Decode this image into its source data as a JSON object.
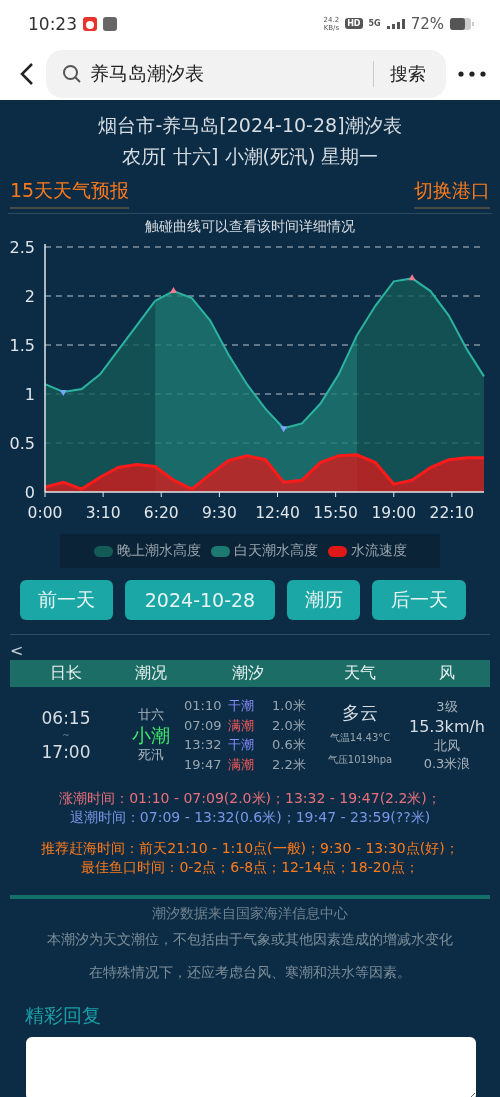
{
  "status_bar": {
    "time": "10:23",
    "net_speed": "24.2",
    "net_unit": "KB/s",
    "hd": "HD",
    "network": "5G",
    "battery": "72%"
  },
  "search_bar": {
    "query": "养马岛潮汐表",
    "button": "搜索"
  },
  "header": {
    "title": "烟台市-养马岛[2024-10-28]潮汐表",
    "subtitle": "农历[ 廿六] 小潮(死汛) 星期一",
    "links": [
      "15天天气预报",
      "切换港口"
    ],
    "hint": "触碰曲线可以查看该时间详细情况"
  },
  "chart_data": {
    "type": "area",
    "x": [
      0,
      60,
      120,
      180,
      240,
      300,
      360,
      420,
      480,
      540,
      600,
      660,
      720,
      780,
      840,
      900,
      960,
      1020,
      1080,
      1140,
      1200,
      1260,
      1320,
      1380,
      1435
    ],
    "xlim": [
      0,
      1435
    ],
    "ylim": [
      0,
      2.5
    ],
    "xticks": [
      {
        "value": 0,
        "label": "0:00"
      },
      {
        "value": 190,
        "label": "3:10"
      },
      {
        "value": 380,
        "label": "6:20"
      },
      {
        "value": 570,
        "label": "9:30"
      },
      {
        "value": 760,
        "label": "12:40"
      },
      {
        "value": 950,
        "label": "15:50"
      },
      {
        "value": 1140,
        "label": "19:00"
      },
      {
        "value": 1330,
        "label": "22:10"
      }
    ],
    "yticks": [
      0,
      {
        "value": 0.5,
        "label": "0.5"
      },
      1,
      {
        "value": 1.5,
        "label": "1.5"
      },
      2,
      {
        "value": 2.5,
        "label": "2.5"
      }
    ],
    "series": [
      {
        "name": "晚上潮水高度",
        "color": "#145a57",
        "values": [
          1.1,
          1.02,
          1.05,
          1.2,
          1.45,
          1.7,
          1.95,
          null,
          null,
          null,
          null,
          null,
          null,
          null,
          null,
          null,
          null,
          1.6,
          1.9,
          2.15,
          2.18,
          2.05,
          1.8,
          1.45,
          1.18
        ]
      },
      {
        "name": "白天潮水高度",
        "color": "#1d7a72",
        "values": [
          null,
          null,
          null,
          null,
          null,
          null,
          1.95,
          2.05,
          1.98,
          1.75,
          1.4,
          1.1,
          0.85,
          0.65,
          0.7,
          0.9,
          1.2,
          1.6,
          null,
          null,
          null,
          null,
          null,
          null,
          null
        ]
      },
      {
        "name": "水流速度",
        "color": "#e01818",
        "values": [
          0.05,
          0.1,
          0.03,
          0.15,
          0.25,
          0.28,
          0.26,
          0.12,
          0.03,
          0.18,
          0.32,
          0.37,
          0.33,
          0.1,
          0.12,
          0.3,
          0.37,
          0.38,
          0.3,
          0.08,
          0.12,
          0.25,
          0.33,
          0.35,
          0.35
        ]
      }
    ],
    "grid": true
  },
  "buttons": [
    {
      "label": "前一天"
    },
    {
      "label": "2024-10-28"
    },
    {
      "label": "潮历"
    },
    {
      "label": "后一天"
    }
  ],
  "back_link": "<",
  "table": {
    "columns": [
      "日长",
      "潮况",
      "潮汐",
      "天气",
      "风"
    ],
    "daylight": {
      "rise": "06:15",
      "separator": "~",
      "set": "17:00"
    },
    "tide_state": {
      "lunar": "廿六",
      "level": "小潮",
      "phase": "死汛"
    },
    "tides": [
      {
        "time": "01:10",
        "kind": "low",
        "label": "干潮",
        "height": "1.0米"
      },
      {
        "time": "07:09",
        "kind": "high",
        "label": "满潮",
        "height": "2.0米"
      },
      {
        "time": "13:32",
        "kind": "low",
        "label": "干潮",
        "height": "0.6米"
      },
      {
        "time": "19:47",
        "kind": "high",
        "label": "满潮",
        "height": "2.2米"
      }
    ],
    "weather": {
      "condition": "多云",
      "temperature": "气温14.43°C",
      "pressure": "气压1019hpa"
    },
    "wind": {
      "scale": "3级",
      "speed": "15.3km/h",
      "direction": "北风",
      "wave": "0.3米浪"
    }
  },
  "tide_times": [
    {
      "kind": "rise",
      "label": "涨潮时间：",
      "text": "01:10 - 07:09(2.0米)；13:32 - 19:47(2.2米)；"
    },
    {
      "kind": "fall",
      "label": "退潮时间：",
      "text": "07:09 - 13:32(0.6米)；19:47 - 23:59(??米)"
    }
  ],
  "advice": [
    {
      "label": "推荐赶海时间：",
      "text": "前天21:10 - 1:10点(一般)；9:30 - 13:30点(好)；"
    },
    {
      "label": "最佳鱼口时间：",
      "text": "0-2点；6-8点；12-14点；18-20点；"
    }
  ],
  "source": "潮汐数据来自国家海洋信息中心",
  "notes": [
    "本潮汐为天文潮位，不包括由于气象或其他因素造成的增减水变化",
    "在特殊情况下，还应考虑台风、寒潮和洪水等因素。"
  ],
  "replies": {
    "title": "精彩回复"
  }
}
